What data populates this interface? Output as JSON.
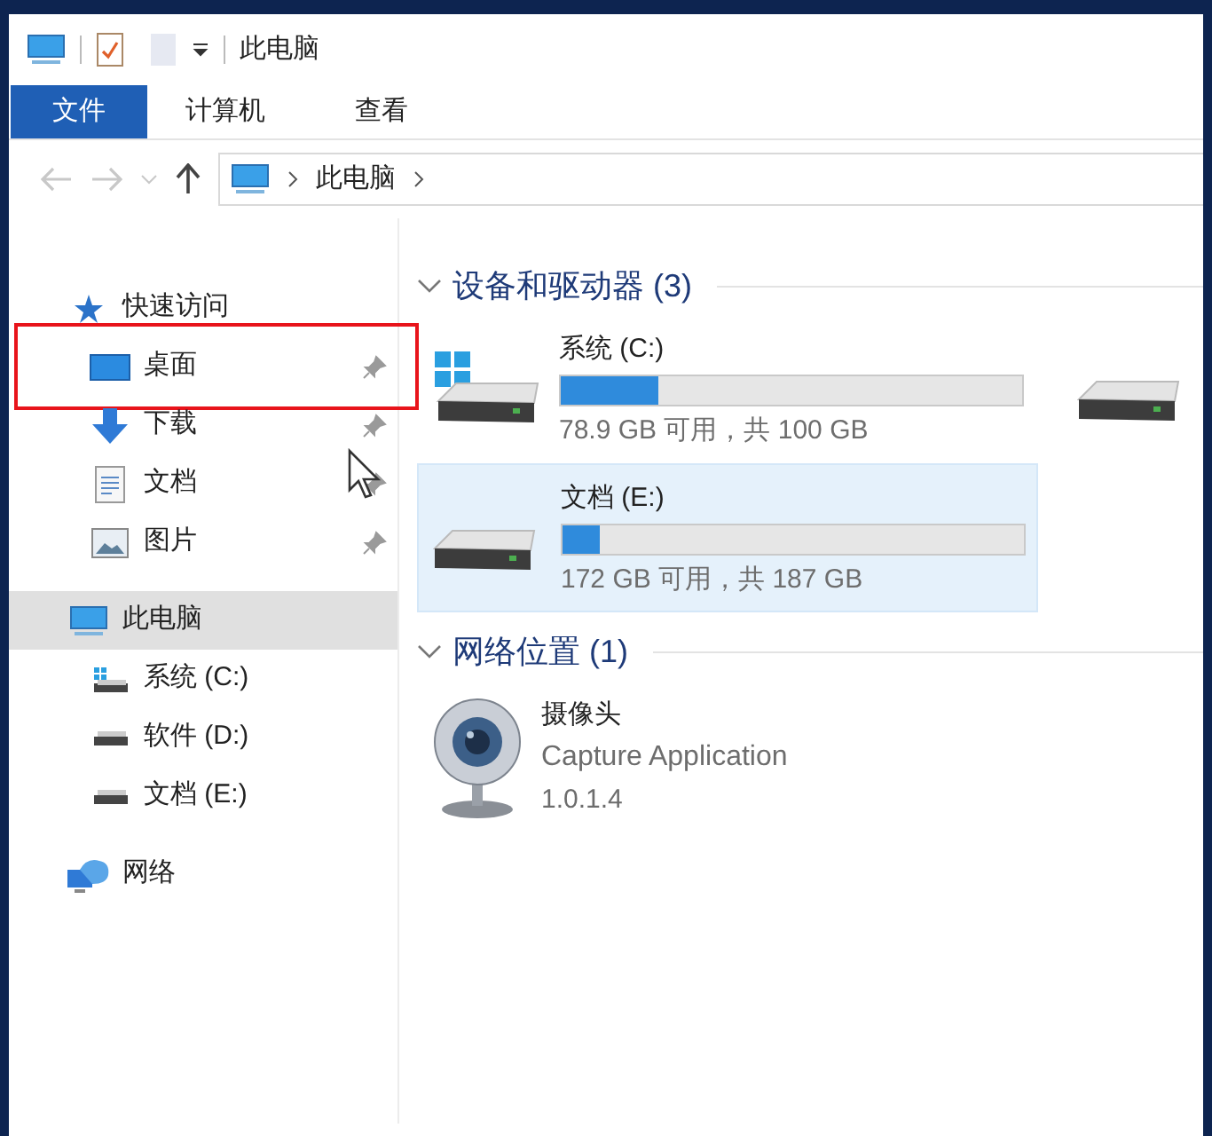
{
  "title_bar": {
    "title": "此电脑"
  },
  "ribbon_tabs": [
    {
      "label": "文件",
      "selected": true
    },
    {
      "label": "计算机",
      "selected": false
    },
    {
      "label": "查看",
      "selected": false
    }
  ],
  "address_bar": {
    "path": [
      "此电脑"
    ]
  },
  "sidebar": {
    "items": [
      {
        "label": "快速访问",
        "kind": "star",
        "selected": false,
        "children": [
          {
            "label": "桌面",
            "kind": "desktop",
            "pinned": true,
            "highlighted": true,
            "selected": false
          },
          {
            "label": "下载",
            "kind": "download",
            "pinned": true,
            "highlighted": false,
            "selected": false
          },
          {
            "label": "文档",
            "kind": "document",
            "pinned": true,
            "highlighted": false,
            "selected": false
          },
          {
            "label": "图片",
            "kind": "picture",
            "pinned": true,
            "highlighted": false,
            "selected": false
          }
        ]
      },
      {
        "label": "此电脑",
        "kind": "pc",
        "selected": true,
        "children": [
          {
            "label": "系统 (C:)",
            "kind": "system_drive",
            "selected": false
          },
          {
            "label": "软件 (D:)",
            "kind": "drive",
            "selected": false
          },
          {
            "label": "文档 (E:)",
            "kind": "drive",
            "selected": false
          }
        ]
      },
      {
        "label": "网络",
        "kind": "network",
        "selected": false
      }
    ]
  },
  "sections": [
    {
      "title": "设备和驱动器 (3)",
      "expanded": true,
      "items": [
        {
          "kind": "system_drive",
          "label": "系统 (C:)",
          "level": 0.21,
          "detail": "78.9 GB 可用，共 100 GB",
          "selected": false
        },
        {
          "kind": "cut_off_drive"
        },
        {
          "kind": "drive",
          "label": "文档 (E:)",
          "level": 0.08,
          "detail": "172 GB 可用，共 187 GB",
          "selected": true
        }
      ]
    },
    {
      "title": "网络位置 (1)",
      "expanded": true,
      "items": [
        {
          "kind": "device",
          "label": "摄像头",
          "description": "Capture Application",
          "version": "1.0.1.4",
          "selected": false
        }
      ]
    }
  ]
}
